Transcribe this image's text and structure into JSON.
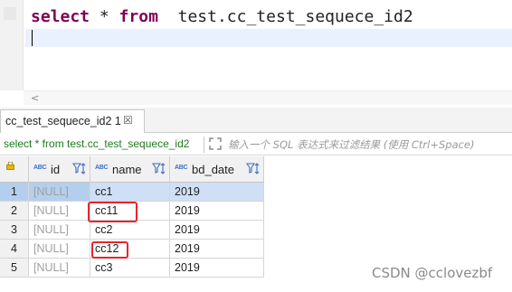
{
  "editor": {
    "sql_keyword_select": "select",
    "sql_star": "*",
    "sql_keyword_from": "from",
    "sql_table": "test.cc_test_sequece_id2"
  },
  "scrollbar": {
    "left_arrow": "<"
  },
  "result_tab": {
    "label": "cc_test_sequece_id2 1",
    "close": "☒"
  },
  "filter_bar": {
    "query": "select * from test.cc_test_sequece_id2",
    "placeholder": "输入一个 SQL 表达式来过滤结果 (使用 Ctrl+Space)"
  },
  "grid": {
    "type_badge": "ABC",
    "columns": [
      {
        "name": "id",
        "type": "ABC"
      },
      {
        "name": "name",
        "type": "ABC"
      },
      {
        "name": "bd_date",
        "type": "ABC"
      }
    ],
    "rows": [
      {
        "num": "1",
        "id": "[NULL]",
        "name": "cc1",
        "bd_date": "2019"
      },
      {
        "num": "2",
        "id": "[NULL]",
        "name": "cc11",
        "bd_date": "2019"
      },
      {
        "num": "3",
        "id": "[NULL]",
        "name": "cc2",
        "bd_date": "2019"
      },
      {
        "num": "4",
        "id": "[NULL]",
        "name": "cc12",
        "bd_date": "2019"
      },
      {
        "num": "5",
        "id": "[NULL]",
        "name": "cc3",
        "bd_date": "2019"
      }
    ],
    "selected_row": "1",
    "highlighted_names": [
      "cc11",
      "cc12"
    ]
  },
  "watermark": "CSDN @cclovezbf",
  "colors": {
    "keyword": "#7f0055",
    "query_text": "#1e7a1e",
    "selection": "#b4cfee",
    "highlight_box": "#e5262b",
    "type_badge": "#3b6fc2"
  }
}
